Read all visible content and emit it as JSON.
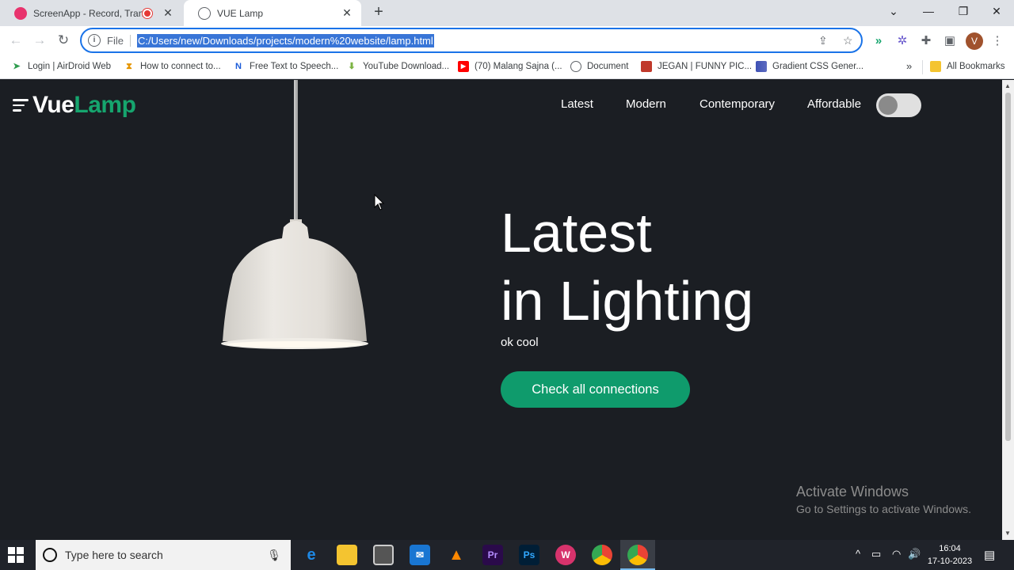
{
  "browser": {
    "tabs": [
      {
        "title": "ScreenApp - Record, Transc",
        "favicon": "screenapp-icon",
        "recording": true
      },
      {
        "title": "VUE Lamp",
        "favicon": "globe-icon",
        "active": true
      }
    ],
    "address": {
      "scheme_label": "File",
      "url": "C:/Users/new/Downloads/projects/modern%20website/lamp.html"
    },
    "profile_initial": "V",
    "bookmarks": [
      {
        "label": "Login | AirDroid Web",
        "icon": "airdroid-icon"
      },
      {
        "label": "How to connect to...",
        "icon": "hourglass-icon"
      },
      {
        "label": "Free Text to Speech...",
        "icon": "n-logo-icon"
      },
      {
        "label": "YouTube Download...",
        "icon": "download-arrow-icon"
      },
      {
        "label": "(70) Malang Sajna (...",
        "icon": "youtube-icon"
      },
      {
        "label": "Document",
        "icon": "globe-icon"
      },
      {
        "label": "JEGAN | FUNNY PIC...",
        "icon": "photo-icon"
      },
      {
        "label": "Gradient CSS Gener...",
        "icon": "gradient-icon"
      }
    ],
    "all_bookmarks_label": "All Bookmarks"
  },
  "site": {
    "logo_part1": "Vue",
    "logo_part2": "Lamp",
    "nav": [
      "Latest",
      "Modern",
      "Contemporary",
      "Affordable"
    ],
    "theme_toggle_on": false,
    "hero": {
      "title_line1": "Latest",
      "title_line2": "in Lighting",
      "subtitle": "ok cool",
      "cta": "Check all connections"
    },
    "colors": {
      "background": "#1b1e23",
      "accent": "#0f9b6c",
      "logo_accent": "#16a56e"
    }
  },
  "watermark": {
    "line1": "Activate Windows",
    "line2": "Go to Settings to activate Windows."
  },
  "taskbar": {
    "search_placeholder": "Type here to search",
    "apps": [
      "edge",
      "file-explorer",
      "store",
      "mail",
      "vlc",
      "premiere-pro",
      "photoshop",
      "wps-office",
      "chrome",
      "chrome-active"
    ],
    "time": "16:04",
    "date": "17-10-2023"
  }
}
